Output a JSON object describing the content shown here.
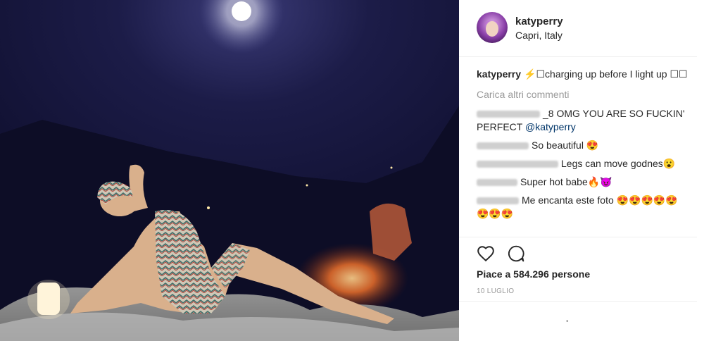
{
  "post": {
    "username": "katyperry",
    "location": "Capri, Italy",
    "caption_username": "katyperry",
    "caption_text": "⚡☐charging up before I light up ☐☐"
  },
  "load_more_label": "Carica altri commenti",
  "comments": [
    {
      "text_a": "_8 OMG YOU ARE SO FUCKIN' PERFECT ",
      "mention": "@katyperry"
    },
    {
      "text": "So beautiful 😍"
    },
    {
      "text": "Legs can move godnes😮"
    },
    {
      "text": "Super hot babe🔥😈"
    },
    {
      "text": "Me encanta este foto 😍😍😍😍😍😍😍😍"
    }
  ],
  "likes_text": "Piace a 584.296 persone",
  "date_text": "10 LUGLIO",
  "more_dots": "•"
}
